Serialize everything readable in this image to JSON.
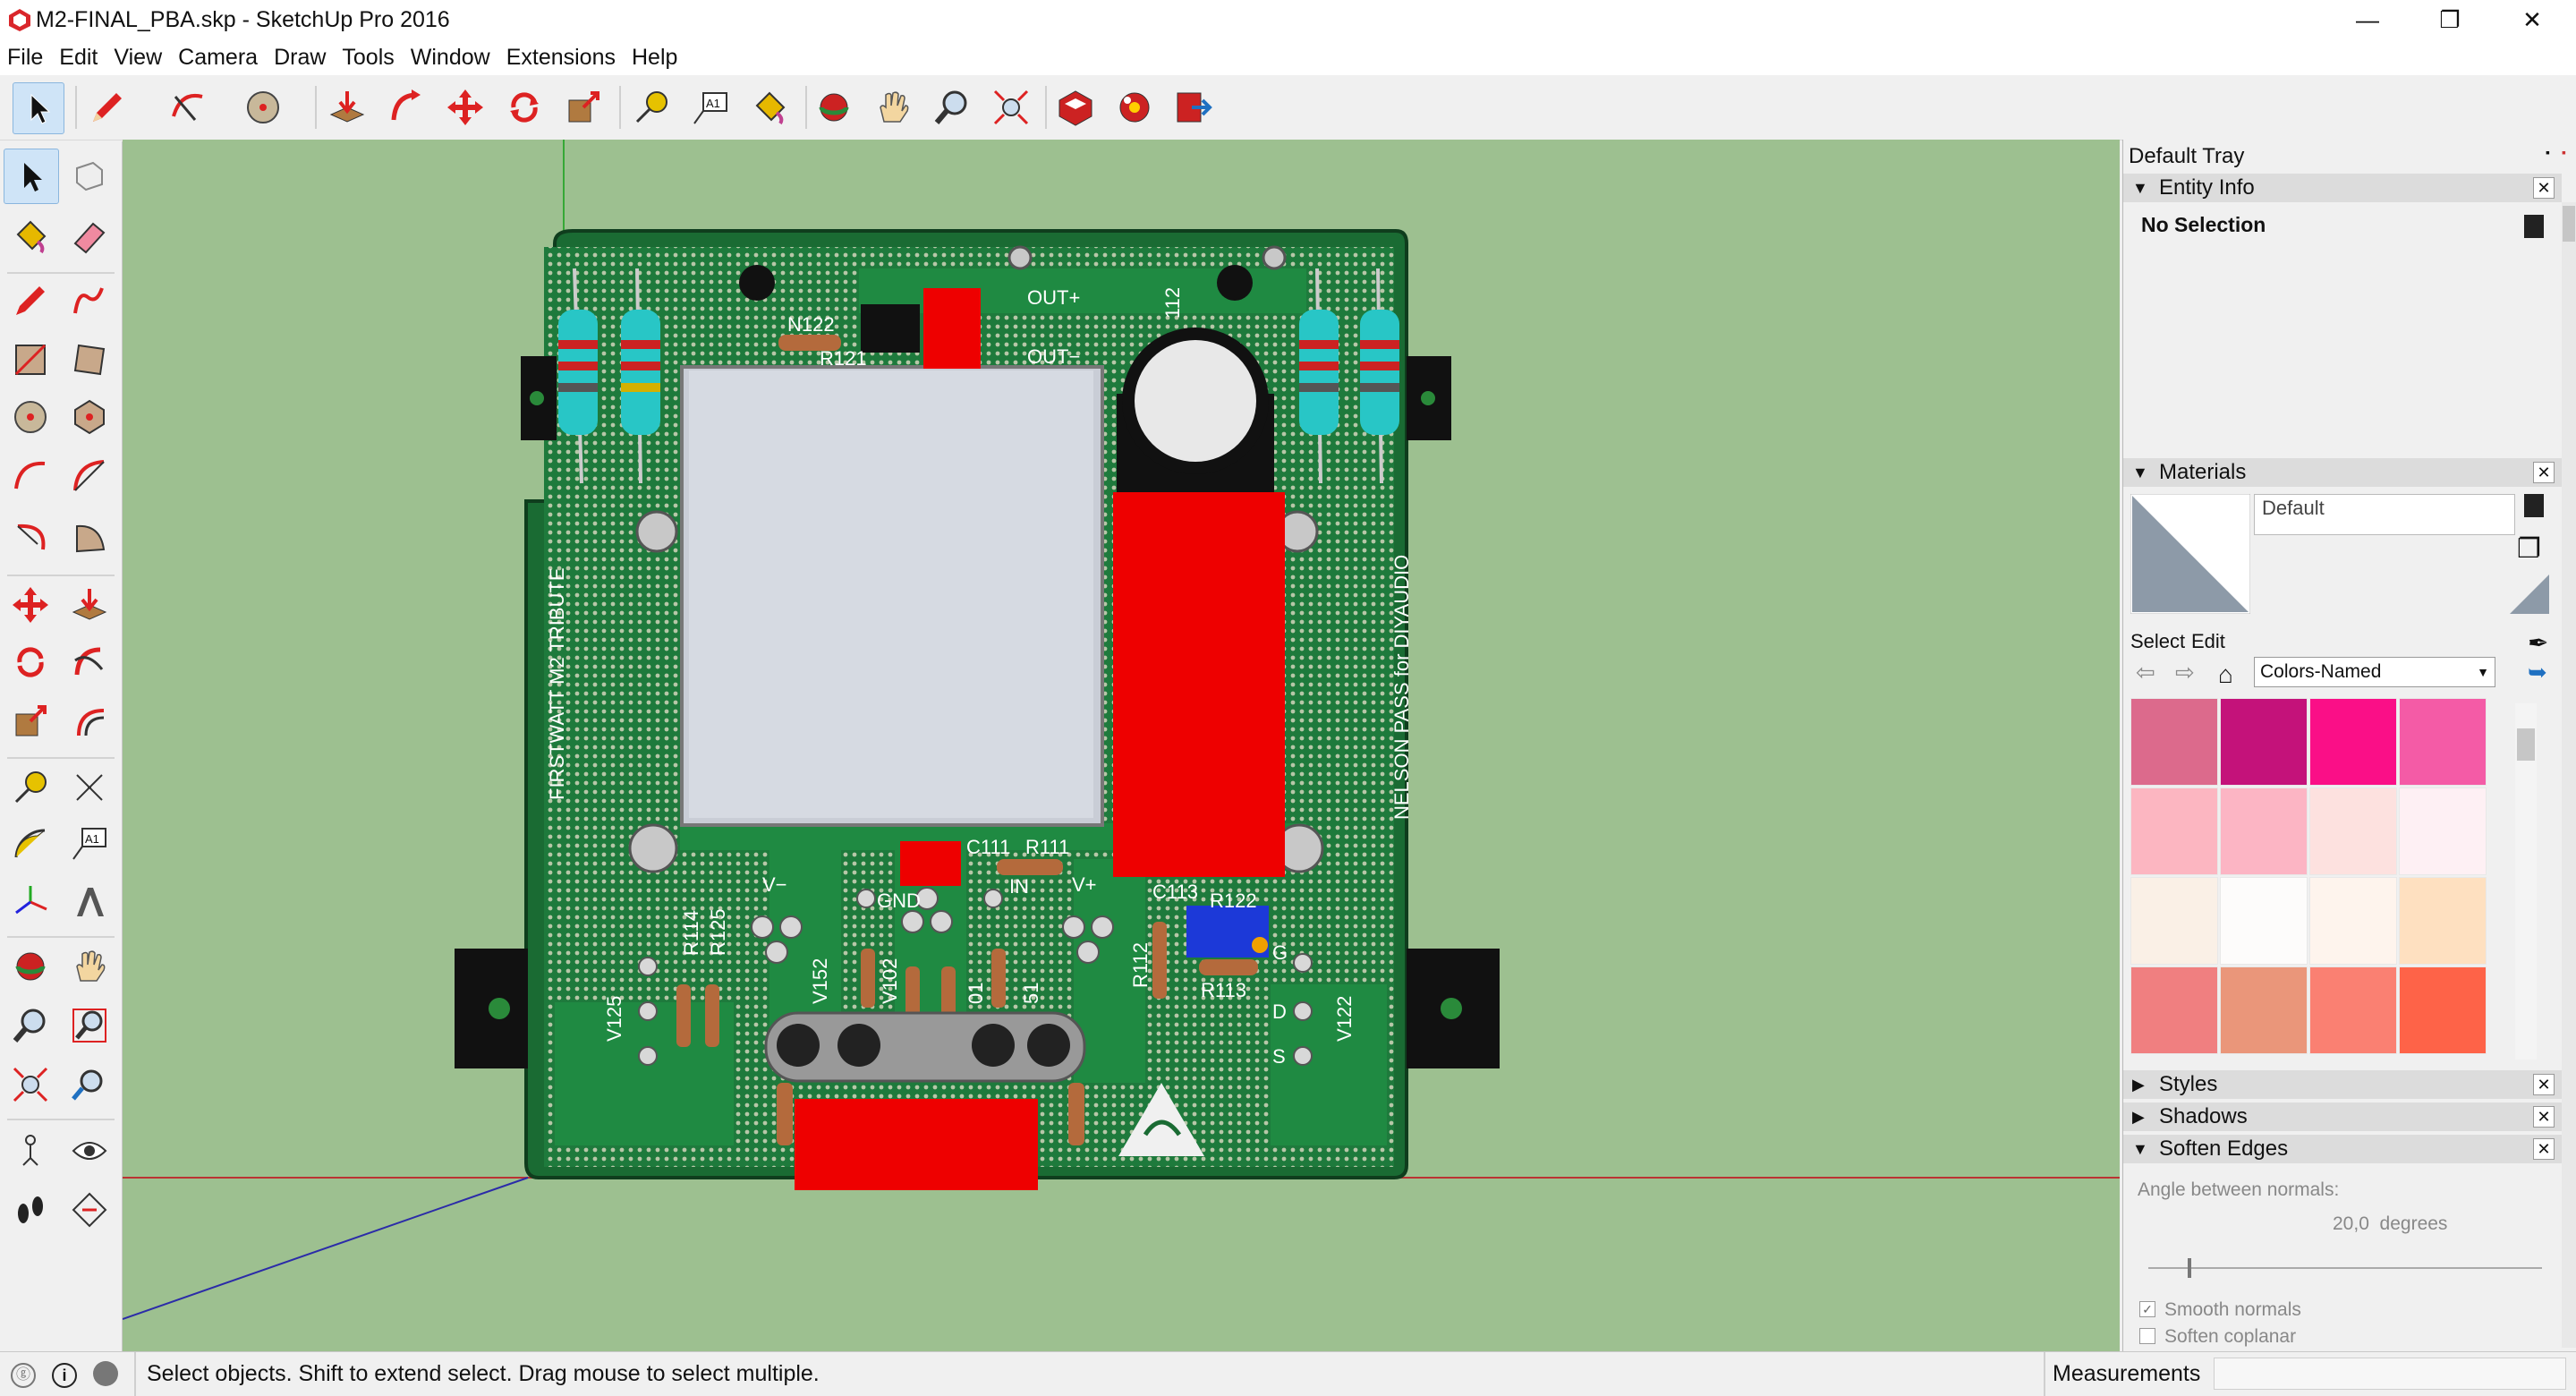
{
  "window": {
    "title": "M2-FINAL_PBA.skp - SketchUp Pro 2016",
    "controls": [
      "—",
      "❐",
      "✕"
    ]
  },
  "menu": [
    "File",
    "Edit",
    "View",
    "Camera",
    "Draw",
    "Tools",
    "Window",
    "Extensions",
    "Help"
  ],
  "board": {
    "labels": {
      "out_pos": "OUT+",
      "out_neg": "OUT−",
      "left_side": "FIRSTWATT M2 TRIBUTE",
      "right_side": "NELSON PASS for DIYAUDIO",
      "v_neg": "V−",
      "v_pos": "V+",
      "gnd": "GND",
      "in": "IN",
      "c111": "C111",
      "r111": "R111",
      "c113": "C113",
      "r122": "R122",
      "r113": "R113",
      "r114": "R114",
      "r125": "R125",
      "r112": "R112",
      "v125": "V125",
      "v122": "V122",
      "v152": "V152",
      "v102": "V102",
      "v01": "01",
      "v51": "51",
      "n122": "N122",
      "r121": "R121",
      "q112": "112",
      "pin_g": "G",
      "pin_d": "D",
      "pin_s": "S"
    }
  },
  "tray": {
    "title": "Default Tray",
    "entity_info": {
      "header": "Entity Info",
      "selection": "No Selection"
    },
    "materials": {
      "header": "Materials",
      "name": "Default",
      "tab_select": "Select",
      "tab_edit": "Edit",
      "library": "Colors-Named",
      "swatches": [
        "#dc6a8c",
        "#c4127a",
        "#fa0f87",
        "#f45ba6",
        "#fcb6c1",
        "#fcb5c4",
        "#fde1df",
        "#fef0f4",
        "#faf0e6",
        "#fdfcfb",
        "#fef4ed",
        "#fee0c0",
        "#f07f80",
        "#ea967a",
        "#fa8072",
        "#fe6348"
      ]
    },
    "styles": {
      "header": "Styles"
    },
    "shadows": {
      "header": "Shadows"
    },
    "soften_edges": {
      "header": "Soften Edges",
      "angle_label": "Angle between normals:",
      "angle_value": "20,0  degrees",
      "angle_fraction": 0.1,
      "smooth_normals": "Smooth normals",
      "smooth_normals_checked": true,
      "soften_coplanar": "Soften coplanar",
      "soften_coplanar_checked": false
    }
  },
  "status": {
    "hint": "Select objects. Shift to extend select. Drag mouse to select multiple.",
    "measurements_label": "Measurements",
    "measurements_value": ""
  }
}
